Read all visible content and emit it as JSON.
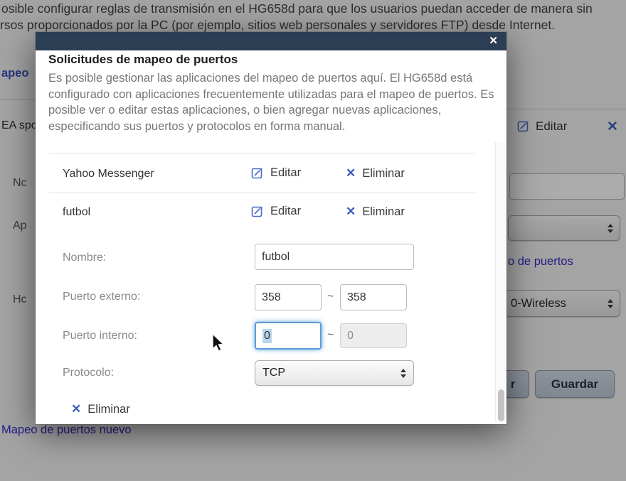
{
  "colors": {
    "modal_header": "#2c3e54",
    "link_blue": "#3226c9",
    "icon_blue": "#3a5fc0",
    "focus_ring": "#5e9bd8"
  },
  "icons": {
    "close": "✕",
    "delete_x": "✕",
    "edit": "pencil-square-icon"
  },
  "background": {
    "intro_line1": "osible configurar reglas de transmisión en el HG658d para que los usuarios puedan acceder de manera sin",
    "intro_line2": "rsos proporcionados por la PC (por ejemplo, sitios web personales y servidores FTP) desde Internet.",
    "tab_partial": "apeo",
    "row_partial": "EA spo",
    "label_nombre_partial": "Nc",
    "label_aplicacion_partial": "Ap",
    "label_host_partial": "Hc",
    "edit_label": "Editar",
    "link_ports_partial": "o de puertos",
    "select_wireless_partial": "0-Wireless",
    "button_cancel_partial": "r",
    "button_save": "Guardar",
    "link_new_mapping": "Mapeo de puertos nuevo"
  },
  "modal": {
    "title": "Solicitudes de mapeo de puertos",
    "description": "Es posible gestionar las aplicaciones del mapeo de puertos aquí. El HG658d está configurado con aplicaciones frecuentemente utilizadas para el mapeo de puertos. Es posible ver o editar estas aplicaciones, o bien agregar nuevas aplicaciones, especificando sus puertos y protocolos en forma manual.",
    "rows": [
      {
        "name": "Yahoo Messenger",
        "edit_label": "Editar",
        "delete_label": "Eliminar"
      },
      {
        "name": "futbol",
        "edit_label": "Editar",
        "delete_label": "Eliminar"
      }
    ],
    "form": {
      "name_label": "Nombre:",
      "name_value": "futbol",
      "external_label": "Puerto externo:",
      "external_from": "358",
      "external_to": "358",
      "tilde": "~",
      "internal_label": "Puerto interno:",
      "internal_from": "0",
      "internal_to": "0",
      "protocol_label": "Protocolo:",
      "protocol_value": "TCP",
      "delete_label": "Eliminar"
    }
  }
}
